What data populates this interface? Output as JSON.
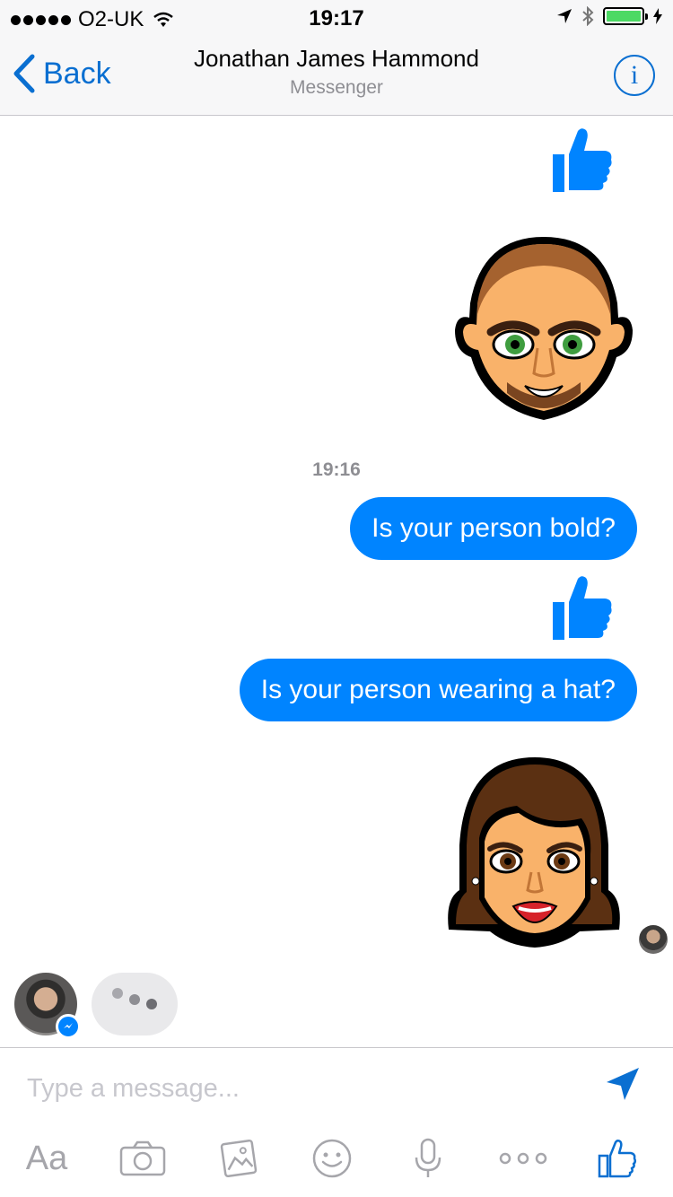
{
  "status_bar": {
    "carrier": "O2-UK",
    "time": "19:17",
    "battery_color": "#4cd964"
  },
  "nav": {
    "back_label": "Back",
    "title": "Jonathan James Hammond",
    "subtitle": "Messenger",
    "info_icon": "i",
    "accent_color": "#0a6fd1"
  },
  "conversation": {
    "timestamp": "19:16",
    "messages": [
      {
        "type": "like",
        "icon": "thumbs-up-icon"
      },
      {
        "type": "sticker",
        "icon": "bald-man-avatar-sticker"
      },
      {
        "type": "text",
        "text": "Is your person bold?"
      },
      {
        "type": "like",
        "icon": "thumbs-up-icon"
      },
      {
        "type": "text",
        "text": "Is your person wearing a hat?"
      },
      {
        "type": "sticker",
        "icon": "brunette-woman-avatar-sticker"
      }
    ],
    "bubble_color": "#0084ff",
    "typing_indicator": true
  },
  "composer": {
    "placeholder": "Type a message...",
    "toolbar": [
      {
        "name": "text-format",
        "label": "Aa"
      },
      {
        "name": "camera",
        "icon": "camera-icon"
      },
      {
        "name": "gallery",
        "icon": "gallery-icon"
      },
      {
        "name": "emoji",
        "icon": "smiley-icon"
      },
      {
        "name": "voice",
        "icon": "microphone-icon"
      },
      {
        "name": "more",
        "icon": "more-icon"
      },
      {
        "name": "like",
        "icon": "thumbs-up-icon"
      }
    ]
  }
}
